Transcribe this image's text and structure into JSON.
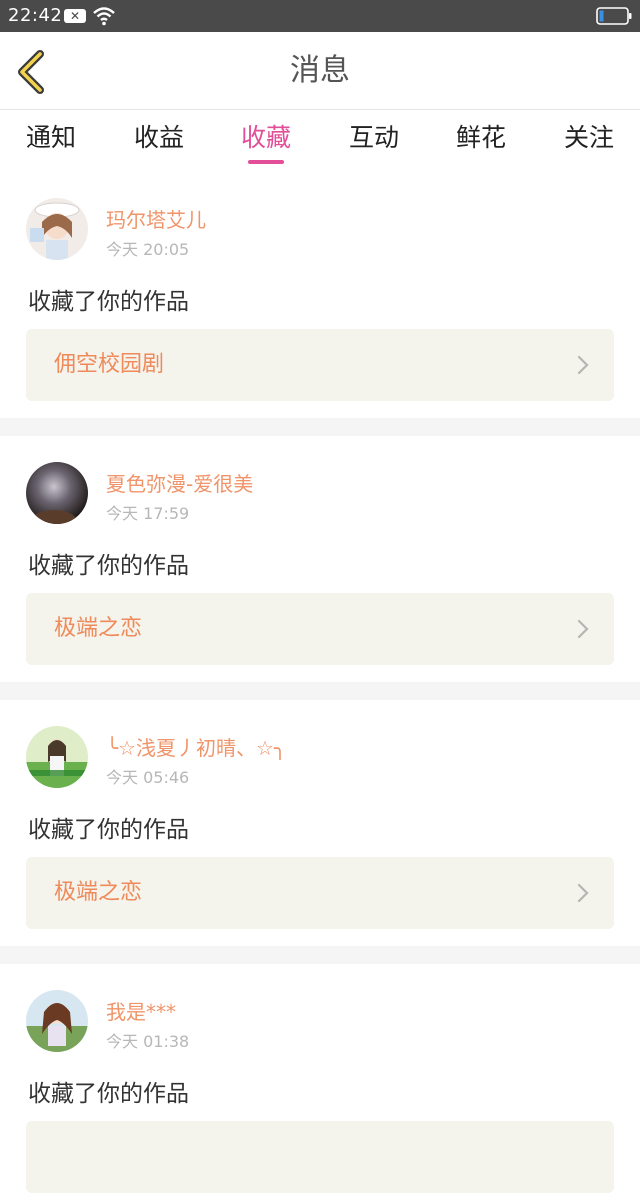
{
  "status_bar": {
    "time": "22:42",
    "notif_icon": "close-x-icon",
    "wifi_icon": "wifi-icon",
    "battery_icon": "battery-icon"
  },
  "header": {
    "back_icon": "chevron-left-icon",
    "title": "消息"
  },
  "tabs": [
    {
      "label": "通知",
      "active": false
    },
    {
      "label": "收益",
      "active": false
    },
    {
      "label": "收藏",
      "active": true
    },
    {
      "label": "互动",
      "active": false
    },
    {
      "label": "鲜花",
      "active": false
    },
    {
      "label": "关注",
      "active": false
    }
  ],
  "colors": {
    "accent": "#e24e98",
    "username": "#f0946a",
    "work_title": "#ef8a5a",
    "card_bg": "#f4f3ec"
  },
  "messages": [
    {
      "username": "玛尔塔艾儿",
      "time": "今天 20:05",
      "action": "收藏了你的作品",
      "work": "佣空校园剧"
    },
    {
      "username": "夏色弥漫-爱很美",
      "time": "今天 17:59",
      "action": "收藏了你的作品",
      "work": "极端之恋"
    },
    {
      "username": "╰☆浅夏丿初晴、☆╮",
      "time": "今天 05:46",
      "action": "收藏了你的作品",
      "work": "极端之恋"
    },
    {
      "username": "我是***",
      "time": "今天 01:38",
      "action": "收藏了你的作品",
      "work": ""
    }
  ]
}
